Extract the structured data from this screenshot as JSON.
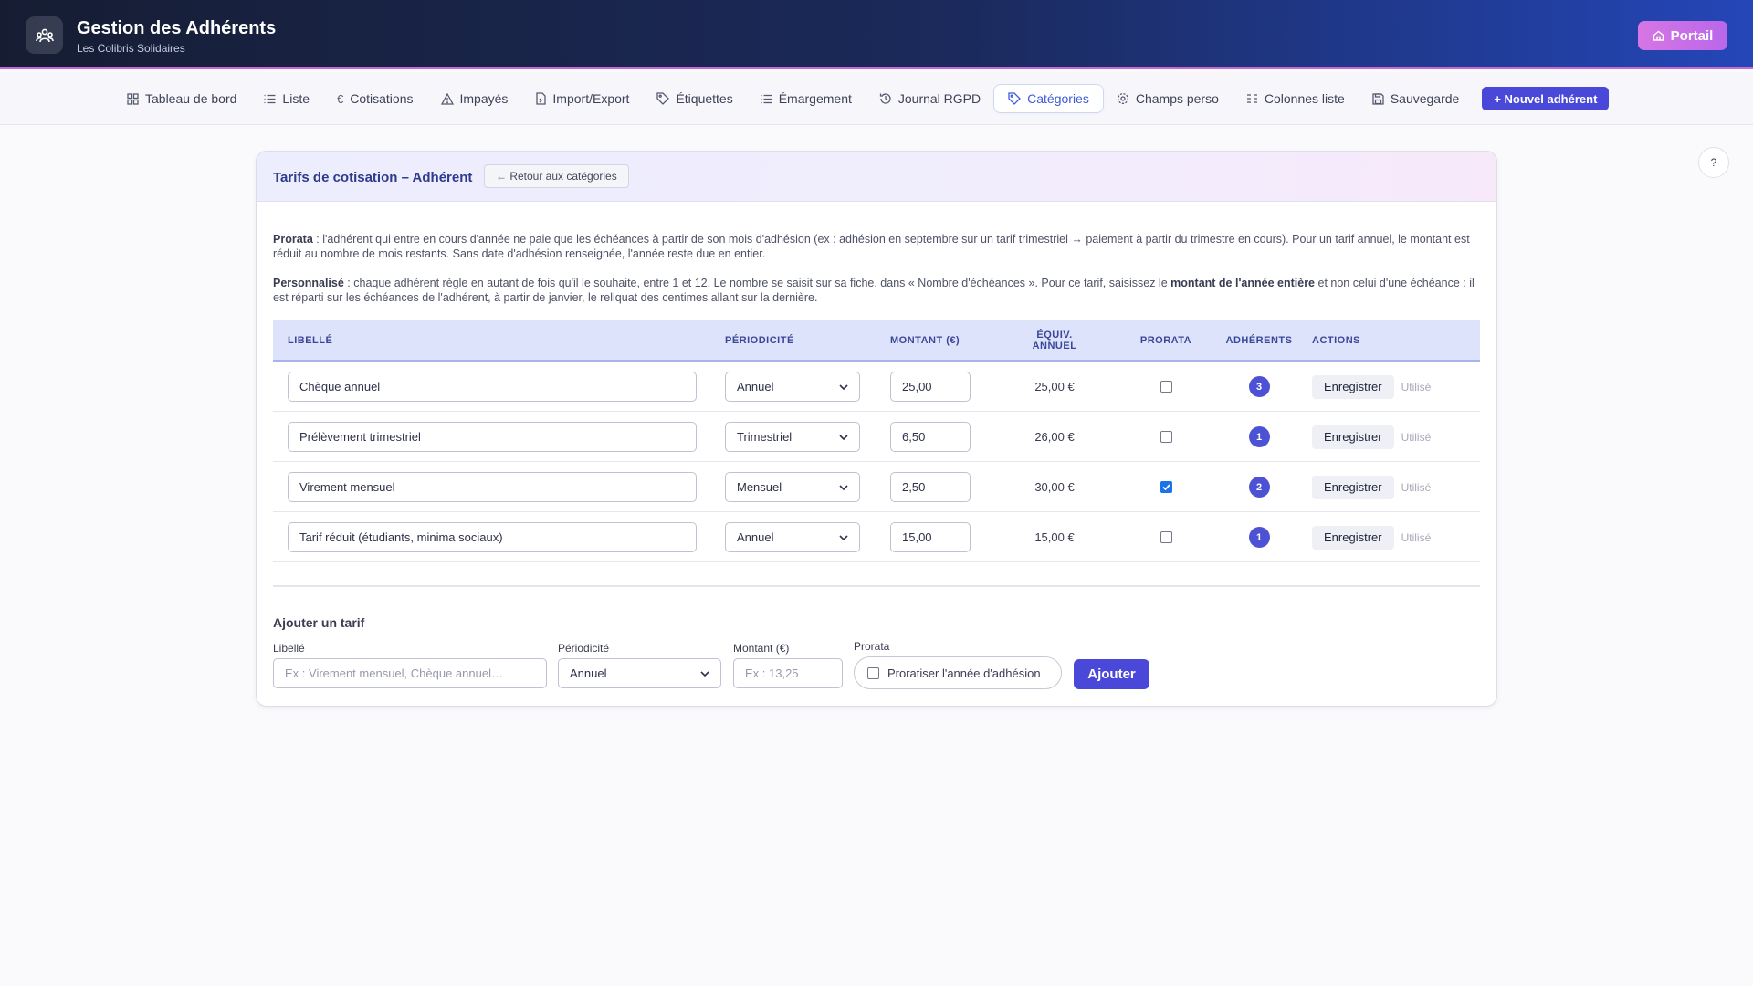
{
  "app": {
    "title": "Gestion des Adhérents",
    "subtitle": "Les Colibris Solidaires",
    "portal_label": "Portail",
    "logo_icon": "people-icon"
  },
  "nav": {
    "items": [
      {
        "label": "Tableau de bord",
        "icon": "dashboard-icon",
        "active": false
      },
      {
        "label": "Liste",
        "icon": "list-icon",
        "active": false
      },
      {
        "label": "Cotisations",
        "icon": "euro-icon",
        "active": false
      },
      {
        "label": "Impayés",
        "icon": "warning-icon",
        "active": false
      },
      {
        "label": "Import/Export",
        "icon": "file-transfer-icon",
        "active": false
      },
      {
        "label": "Étiquettes",
        "icon": "tag-icon",
        "active": false
      },
      {
        "label": "Émargement",
        "icon": "list-icon",
        "active": false
      },
      {
        "label": "Journal RGPD",
        "icon": "history-icon",
        "active": false
      },
      {
        "label": "Catégories",
        "icon": "tag-icon",
        "active": true
      },
      {
        "label": "Champs perso",
        "icon": "gear-icon",
        "active": false
      },
      {
        "label": "Colonnes liste",
        "icon": "columns-icon",
        "active": false
      },
      {
        "label": "Sauvegarde",
        "icon": "save-icon",
        "active": false
      }
    ],
    "new_member_label": "+ Nouvel adhérent",
    "help_label": "?"
  },
  "card": {
    "title": "Tarifs de cotisation – Adhérent",
    "back_label": "← Retour aux catégories",
    "info": {
      "prorata_title": "Prorata",
      "prorata_text": " : l'adhérent qui entre en cours d'année ne paie que les échéances à partir de son mois d'adhésion (ex : adhésion en septembre sur un tarif trimestriel → paiement à partir du trimestre en cours). Pour un tarif annuel, le montant est réduit au nombre de mois restants. Sans date d'adhésion renseignée, l'année reste due en entier.",
      "perso_title": "Personnalisé",
      "perso_text_1": " : chaque adhérent règle en autant de fois qu'il le souhaite, entre 1 et 12. Le nombre se saisit sur sa fiche, dans « Nombre d'échéances ». Pour ce tarif, saisissez le ",
      "perso_bold": "montant de l'année entière",
      "perso_text_2": " et non celui d'une échéance : il est réparti sur les échéances de l'adhérent, à partir de janvier, le reliquat des centimes allant sur la dernière."
    }
  },
  "table": {
    "headers": {
      "libelle": "LIBELLÉ",
      "periodicite": "PÉRIODICITÉ",
      "montant": "MONTANT (€)",
      "equiv_1": "ÉQUIV.",
      "equiv_2": "ANNUEL",
      "prorata": "PRORATA",
      "adherents": "ADHÉRENTS",
      "actions": "ACTIONS"
    },
    "save_label": "Enregistrer",
    "used_label": "Utilisé",
    "rows": [
      {
        "libelle": "Chèque annuel",
        "periodicite": "Annuel",
        "montant": "25,00",
        "equiv": "25,00 €",
        "prorata": false,
        "adherents": "3"
      },
      {
        "libelle": "Prélèvement trimestriel",
        "periodicite": "Trimestriel",
        "montant": "6,50",
        "equiv": "26,00 €",
        "prorata": false,
        "adherents": "1"
      },
      {
        "libelle": "Virement mensuel",
        "periodicite": "Mensuel",
        "montant": "2,50",
        "equiv": "30,00 €",
        "prorata": true,
        "adherents": "2"
      },
      {
        "libelle": "Tarif réduit (étudiants, minima sociaux)",
        "periodicite": "Annuel",
        "montant": "15,00",
        "equiv": "15,00 €",
        "prorata": false,
        "adherents": "1"
      }
    ]
  },
  "add_form": {
    "title": "Ajouter un tarif",
    "libelle_label": "Libellé",
    "libelle_placeholder": "Ex : Virement mensuel, Chèque annuel…",
    "periodicite_label": "Périodicité",
    "periodicite_value": "Annuel",
    "montant_label": "Montant (€)",
    "montant_placeholder": "Ex : 13,25",
    "prorata_label": "Prorata",
    "prorata_checkbox_label": "Proratiser l'année d'adhésion",
    "submit_label": "Ajouter"
  },
  "colors": {
    "accent": "#4a48d8",
    "active_nav": "#3d5bd8",
    "badge": "#4c52d3"
  }
}
